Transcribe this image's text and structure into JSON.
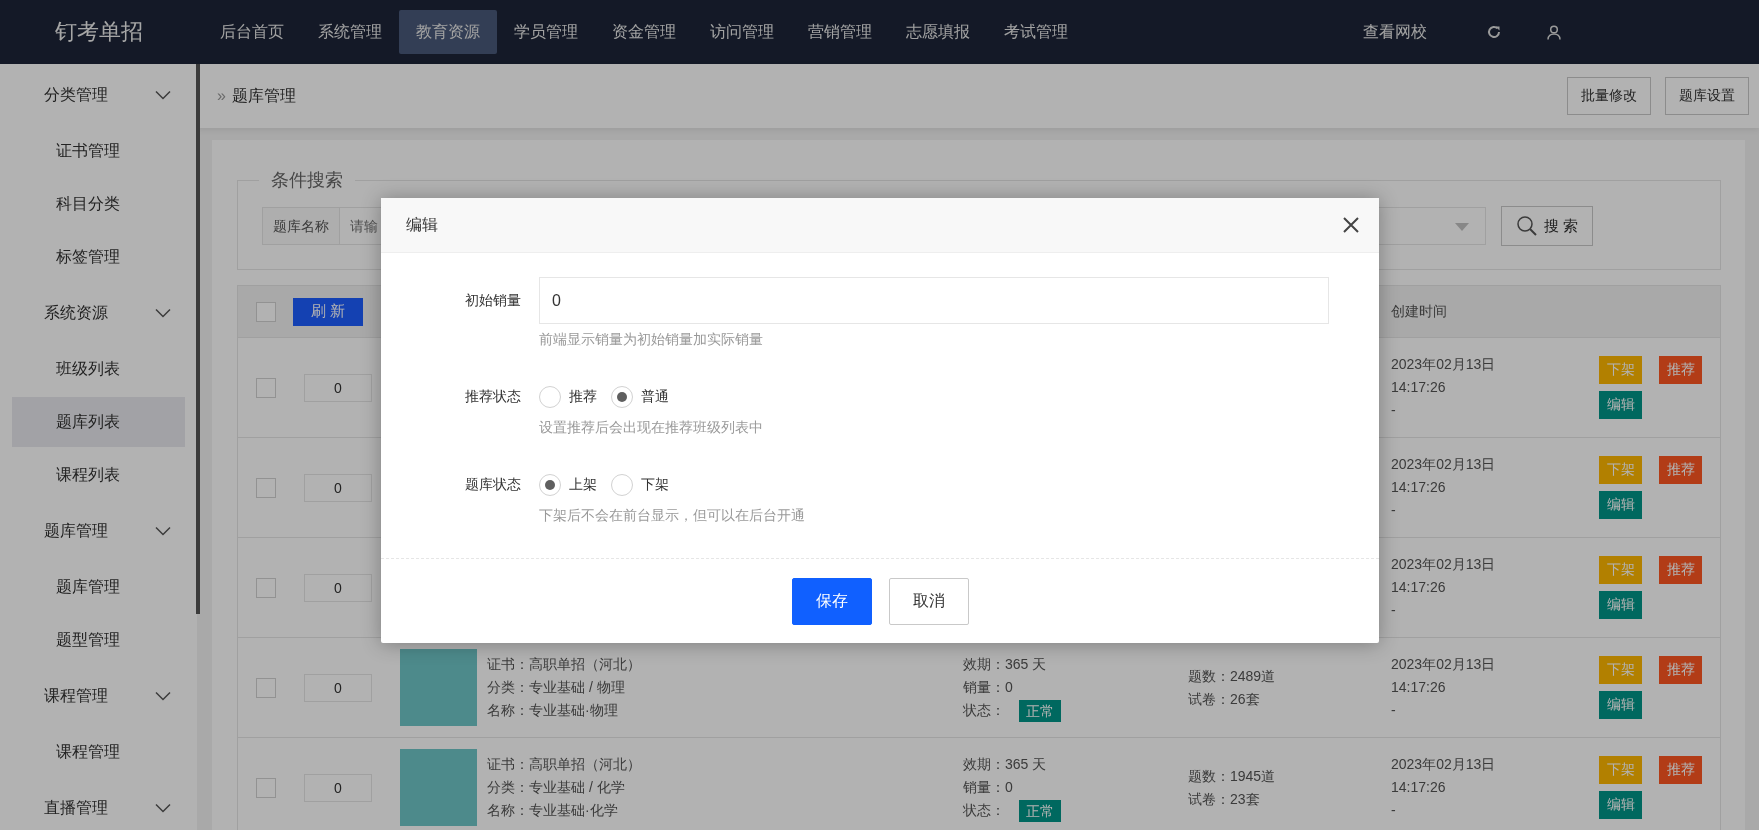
{
  "topbar": {
    "logo": "钉考单招",
    "nav": [
      {
        "label": "后台首页",
        "selected": false
      },
      {
        "label": "系统管理",
        "selected": false
      },
      {
        "label": "教育资源",
        "selected": true
      },
      {
        "label": "学员管理",
        "selected": false
      },
      {
        "label": "资金管理",
        "selected": false
      },
      {
        "label": "访问管理",
        "selected": false
      },
      {
        "label": "营销管理",
        "selected": false
      },
      {
        "label": "志愿填报",
        "selected": false
      },
      {
        "label": "考试管理",
        "selected": false
      }
    ],
    "site_link": "查看网校"
  },
  "sidebar": {
    "items": [
      {
        "label": "分类管理",
        "expanded": true,
        "children": [
          {
            "label": "证书管理",
            "selected": false
          },
          {
            "label": "科目分类",
            "selected": false
          },
          {
            "label": "标签管理",
            "selected": false
          }
        ]
      },
      {
        "label": "系统资源",
        "expanded": true,
        "children": [
          {
            "label": "班级列表",
            "selected": false
          },
          {
            "label": "题库列表",
            "selected": true
          },
          {
            "label": "课程列表",
            "selected": false
          }
        ]
      },
      {
        "label": "题库管理",
        "expanded": true,
        "children": [
          {
            "label": "题库管理",
            "selected": false
          },
          {
            "label": "题型管理",
            "selected": false
          }
        ]
      },
      {
        "label": "课程管理",
        "expanded": true,
        "children": [
          {
            "label": "课程管理",
            "selected": false
          }
        ]
      },
      {
        "label": "直播管理",
        "expanded": true
      }
    ]
  },
  "breadcrumb": {
    "separator": "»",
    "label": "题库管理"
  },
  "header_buttons": [
    "批量修改",
    "题库设置"
  ],
  "search": {
    "legend": "条件搜索",
    "field_label": "题库名称",
    "placeholder": "请输",
    "button": "搜 索"
  },
  "table": {
    "header_checked": false,
    "refresh_button": "刷 新",
    "columns": [
      "创建时间"
    ],
    "rows": [
      {
        "checked": false,
        "sort": "0",
        "created_date": "2023年02月13日",
        "created_time": "14:17:26",
        "note": "-",
        "actions": [
          {
            "label": "下架",
            "kind": "warning"
          },
          {
            "label": "推荐",
            "kind": "danger"
          },
          {
            "label": "编辑",
            "kind": "primary"
          }
        ]
      },
      {
        "checked": false,
        "sort": "0",
        "created_date": "2023年02月13日",
        "created_time": "14:17:26",
        "note": "-",
        "actions": [
          {
            "label": "下架",
            "kind": "warning"
          },
          {
            "label": "推荐",
            "kind": "danger"
          },
          {
            "label": "编辑",
            "kind": "primary"
          }
        ]
      },
      {
        "checked": false,
        "sort": "0",
        "created_date": "2023年02月13日",
        "created_time": "14:17:26",
        "note": "-",
        "actions": [
          {
            "label": "下架",
            "kind": "warning"
          },
          {
            "label": "推荐",
            "kind": "danger"
          },
          {
            "label": "编辑",
            "kind": "primary"
          }
        ]
      },
      {
        "checked": false,
        "sort": "0",
        "cert": "证书：高职单招（河北）",
        "category": "分类：专业基础 / 物理",
        "name": "名称：专业基础·物理",
        "validity": "效期：365 天",
        "sales": "销量：0",
        "status_label": "状态：",
        "status": "正常",
        "questions": "题数：2489道",
        "papers": "试卷：26套",
        "created_date": "2023年02月13日",
        "created_time": "14:17:26",
        "note": "-",
        "actions": [
          {
            "label": "下架",
            "kind": "warning"
          },
          {
            "label": "推荐",
            "kind": "danger"
          },
          {
            "label": "编辑",
            "kind": "primary"
          }
        ]
      },
      {
        "checked": false,
        "sort": "0",
        "cert": "证书：高职单招（河北）",
        "category": "分类：专业基础 / 化学",
        "name": "名称：专业基础·化学",
        "validity": "效期：365 天",
        "sales": "销量：0",
        "status_label": "状态：",
        "status": "正常",
        "questions": "题数：1945道",
        "papers": "试卷：23套",
        "created_date": "2023年02月13日",
        "created_time": "14:17:26",
        "note": "-",
        "actions": [
          {
            "label": "下架",
            "kind": "warning"
          },
          {
            "label": "推荐",
            "kind": "danger"
          },
          {
            "label": "编辑",
            "kind": "primary"
          }
        ]
      }
    ]
  },
  "modal": {
    "title": "编辑",
    "fields": [
      {
        "kind": "input",
        "label": "初始销量",
        "value": "0",
        "hint": "前端显示销量为初始销量加实际销量"
      },
      {
        "kind": "radio",
        "label": "推荐状态",
        "options": [
          {
            "label": "推荐",
            "selected": false
          },
          {
            "label": "普通",
            "selected": true
          }
        ],
        "hint": "设置推荐后会出现在推荐班级列表中"
      },
      {
        "kind": "radio",
        "label": "题库状态",
        "options": [
          {
            "label": "上架",
            "selected": true
          },
          {
            "label": "下架",
            "selected": false
          }
        ],
        "hint": "下架后不会在前台显示，但可以在后台开通"
      }
    ],
    "buttons": [
      {
        "label": "保存",
        "kind": "primary"
      },
      {
        "label": "取消",
        "kind": "default"
      }
    ]
  }
}
